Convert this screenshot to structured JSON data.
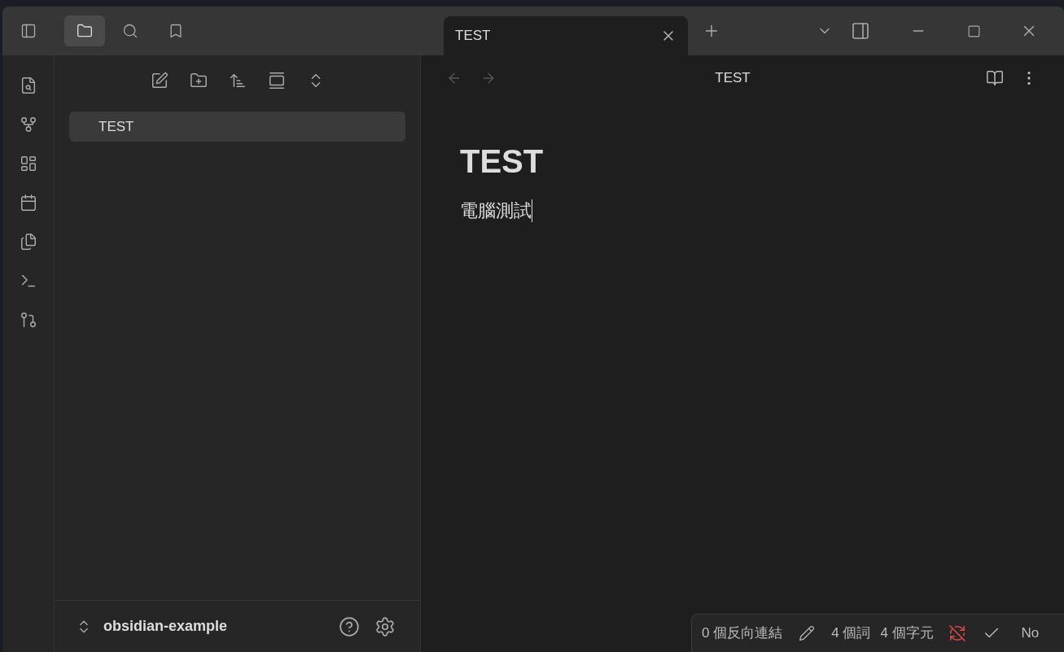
{
  "sidebar_tabs": [
    {
      "kind": "files",
      "selected": true
    },
    {
      "kind": "search",
      "selected": false
    },
    {
      "kind": "bookmarks",
      "selected": false
    }
  ],
  "editor_tabs": [
    {
      "title": "TEST",
      "selected": true
    }
  ],
  "file_tree": [
    {
      "name": "TEST",
      "selected": true
    }
  ],
  "vault": {
    "name": "obsidian-example"
  },
  "editor": {
    "header_title": "TEST",
    "back_disabled": true,
    "forward_disabled": true,
    "heading": "TEST",
    "body": "電腦測試"
  },
  "status_bar": {
    "backlinks": "0 個反向連結",
    "words": "4 個詞",
    "characters": "4 個字元",
    "sync_off": true,
    "mode": "No"
  }
}
